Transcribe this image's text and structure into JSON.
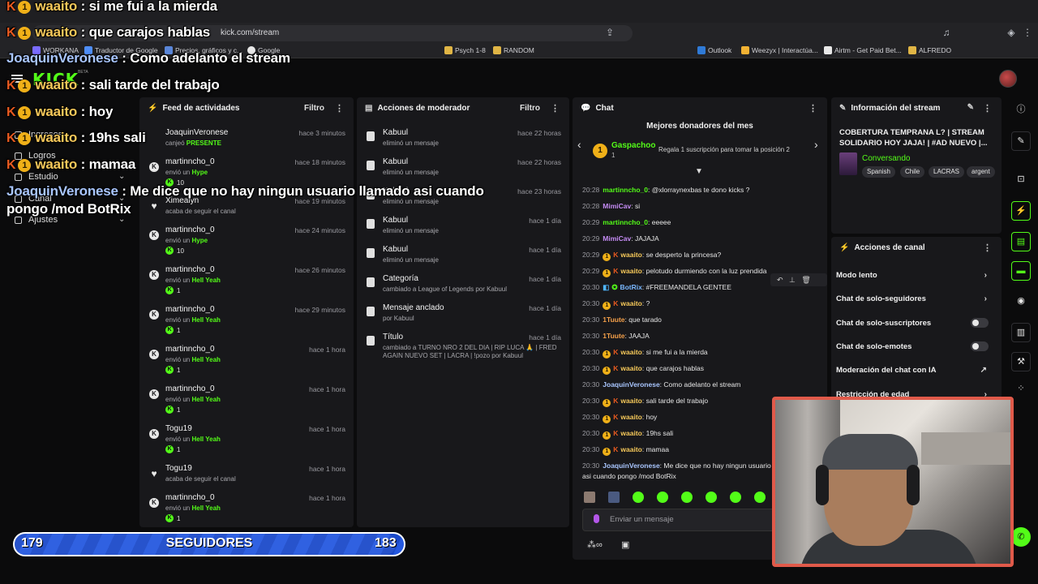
{
  "browser": {
    "url": "kick.com/stream",
    "bookmarks": [
      "WORKANA",
      "Traductor de Google",
      "Precios, gráficos y c...",
      "Google",
      "Psych 1-8",
      "RANDOM",
      "Outlook",
      "Weezyx | Interactúa...",
      "Airtm - Get Paid Bet...",
      "ALFREDO"
    ]
  },
  "kick": {
    "logo": "KICK",
    "beta": "BETA"
  },
  "side_nav": {
    "items": [
      "Ingresos",
      "Logros",
      "Estudio",
      "Canal",
      "Ajustes"
    ]
  },
  "feed": {
    "title": "Feed de actividades",
    "filter": "Filtro",
    "items": [
      {
        "name": "JoaquinVeronese",
        "time": "hace 3 minutos",
        "sub_pre": "canjeó ",
        "sub_hi": "PRESENTE",
        "amount": "",
        "icon": "gift-icon"
      },
      {
        "name": "martinncho_0",
        "time": "hace 18 minutos",
        "sub_pre": "envió un ",
        "sub_hi": "Hype",
        "amount": "10",
        "icon": "kick-coin-icon"
      },
      {
        "name": "Ximealyn",
        "time": "hace 19 minutos",
        "sub_pre": "acaba de seguir el canal",
        "sub_hi": "",
        "amount": "",
        "icon": "heart-icon"
      },
      {
        "name": "martinncho_0",
        "time": "hace 24 minutos",
        "sub_pre": "envió un ",
        "sub_hi": "Hype",
        "amount": "10",
        "icon": "kick-coin-icon"
      },
      {
        "name": "martinncho_0",
        "time": "hace 26 minutos",
        "sub_pre": "envió un ",
        "sub_hi": "Hell Yeah",
        "amount": "1",
        "icon": "kick-coin-icon"
      },
      {
        "name": "martinncho_0",
        "time": "hace 29 minutos",
        "sub_pre": "envió un ",
        "sub_hi": "Hell Yeah",
        "amount": "1",
        "icon": "kick-coin-icon"
      },
      {
        "name": "martinncho_0",
        "time": "hace 1 hora",
        "sub_pre": "envió un ",
        "sub_hi": "Hell Yeah",
        "amount": "1",
        "icon": "kick-coin-icon"
      },
      {
        "name": "martinncho_0",
        "time": "hace 1 hora",
        "sub_pre": "envió un ",
        "sub_hi": "Hell Yeah",
        "amount": "1",
        "icon": "kick-coin-icon"
      },
      {
        "name": "Togu19",
        "time": "hace 1 hora",
        "sub_pre": "envió un ",
        "sub_hi": "Hell Yeah",
        "amount": "1",
        "icon": "kick-coin-icon"
      },
      {
        "name": "Togu19",
        "time": "hace 1 hora",
        "sub_pre": "acaba de seguir el canal",
        "sub_hi": "",
        "amount": "",
        "icon": "heart-icon"
      },
      {
        "name": "martinncho_0",
        "time": "hace 1 hora",
        "sub_pre": "envió un ",
        "sub_hi": "Hell Yeah",
        "amount": "1",
        "icon": "kick-coin-icon"
      }
    ]
  },
  "mod": {
    "title": "Acciones de moderador",
    "filter": "Filtro",
    "items": [
      {
        "name": "Kabuul",
        "time": "hace 22 horas",
        "sub": "eliminó un mensaje",
        "sub2": ""
      },
      {
        "name": "Kabuul",
        "time": "hace 22 horas",
        "sub": "eliminó un mensaje",
        "sub2": ""
      },
      {
        "name": "Kabuul",
        "time": "hace 23 horas",
        "sub": "eliminó un mensaje",
        "sub2": ""
      },
      {
        "name": "Kabuul",
        "time": "hace 1 día",
        "sub": "eliminó un mensaje",
        "sub2": ""
      },
      {
        "name": "Kabuul",
        "time": "hace 1 día",
        "sub": "eliminó un mensaje",
        "sub2": ""
      },
      {
        "name": "Categoría",
        "time": "hace 1 día",
        "sub": "cambiado a League of Legends  por Kabuul",
        "sub2": ""
      },
      {
        "name": "Mensaje anclado",
        "time": "hace 1 día",
        "sub": "por Kabuul",
        "sub2": ""
      },
      {
        "name": "Título",
        "time": "hace 1 día",
        "sub": "cambiado a TURNO NRO 2 DEL DIA | RIP LUCA 🙏 | FRED",
        "sub2": "AGAIN NUEVO SET | LACRA | !pozo  por Kabuul"
      }
    ]
  },
  "chat": {
    "title": "Chat",
    "donors_title": "Mejores donadores del mes",
    "donor_name": "Gaspachoo",
    "donor_pos": "1",
    "donor_promo": "Regala 1 suscripción para tomar la posición 2",
    "input_placeholder": "Enviar un mensaje",
    "messages": [
      {
        "t": "20:28",
        "u": "martinncho_0",
        "m": ": @xlorraynexbas te dono kicks ?",
        "c": "#53fc18",
        "badge": false
      },
      {
        "t": "20:28",
        "u": "MimiCav",
        "m": ": si",
        "c": "#c58cf5",
        "badge": false
      },
      {
        "t": "20:29",
        "u": "martinncho_0",
        "m": ": eeeee",
        "c": "#53fc18",
        "badge": false
      },
      {
        "t": "20:29",
        "u": "MimiCav",
        "m": ": JAJAJA",
        "c": "#c58cf5",
        "badge": false
      },
      {
        "t": "20:29",
        "u": "waaito",
        "m": ": se desperto la princesa?",
        "c": "#f5c85a",
        "badge": true
      },
      {
        "t": "20:29",
        "u": "waaito",
        "m": ": pelotudo durmiendo con la luz prendida",
        "c": "#f5c85a",
        "badge": true
      },
      {
        "t": "20:30",
        "u": "BotRix",
        "m": ": #FREEMANDELA GENTEE",
        "c": "#7ab8ff",
        "badge": false
      },
      {
        "t": "20:30",
        "u": "waaito",
        "m": ": ?",
        "c": "#f5c85a",
        "badge": true
      },
      {
        "t": "20:30",
        "u": "1Tuute",
        "m": ": que tarado",
        "c": "#f5a04a",
        "badge": false
      },
      {
        "t": "20:30",
        "u": "1Tuute",
        "m": ": JAAJA",
        "c": "#f5a04a",
        "badge": false
      },
      {
        "t": "20:30",
        "u": "waaito",
        "m": ": si me fui a la mierda",
        "c": "#f5c85a",
        "badge": true
      },
      {
        "t": "20:30",
        "u": "waaito",
        "m": ": que carajos hablas",
        "c": "#f5c85a",
        "badge": true
      },
      {
        "t": "20:30",
        "u": "JoaquinVeronese",
        "m": ": Como adelanto el stream",
        "c": "#a9c6ff",
        "badge": false
      },
      {
        "t": "20:30",
        "u": "waaito",
        "m": ": sali tarde del trabajo",
        "c": "#f5c85a",
        "badge": true
      },
      {
        "t": "20:30",
        "u": "waaito",
        "m": ": hoy",
        "c": "#f5c85a",
        "badge": true
      },
      {
        "t": "20:30",
        "u": "waaito",
        "m": ": 19hs sali",
        "c": "#f5c85a",
        "badge": true
      },
      {
        "t": "20:30",
        "u": "waaito",
        "m": ": mamaa",
        "c": "#f5c85a",
        "badge": true
      },
      {
        "t": "20:30",
        "u": "JoaquinVeronese",
        "m": ": Me dice que no hay ningun usuario llamado",
        "c": "#a9c6ff",
        "badge": false
      }
    ],
    "last_wrap": "asi cuando pongo /mod BotRix"
  },
  "stream_info": {
    "title": "Información del stream",
    "stream_title": "COBERTURA TEMPRANA L? | STREAM SOLIDARIO HOY JAJA! | #AD NUEVO |...",
    "category": "Conversando",
    "tags": [
      "Spanish",
      "Chile",
      "LACRAS",
      "argent"
    ]
  },
  "channel_actions": {
    "title": "Acciones de canal",
    "items": [
      {
        "label": "Modo lento",
        "kind": "chevron"
      },
      {
        "label": "Chat de solo-seguidores",
        "kind": "chevron"
      },
      {
        "label": "Chat de solo-suscriptores",
        "kind": "toggle"
      },
      {
        "label": "Chat de solo-emotes",
        "kind": "toggle"
      },
      {
        "label": "Moderación del chat con IA",
        "kind": "link"
      },
      {
        "label": "Restricción de edad",
        "kind": "chevron"
      }
    ]
  },
  "overlay": {
    "lines": [
      {
        "u": "waaito",
        "m": " : si me fui a la mierda",
        "blue": false,
        "badge": true
      },
      {
        "u": "waaito",
        "m": " : que carajos hablas",
        "blue": false,
        "badge": true
      },
      {
        "u": "JoaquinVeronese",
        "m": " : Como adelanto el stream",
        "blue": true,
        "badge": false
      },
      {
        "u": "waaito",
        "m": " : sali tarde del trabajo",
        "blue": false,
        "badge": true
      },
      {
        "u": "waaito",
        "m": " : hoy",
        "blue": false,
        "badge": true
      },
      {
        "u": "waaito",
        "m": " : 19hs sali",
        "blue": false,
        "badge": true
      },
      {
        "u": "waaito",
        "m": " : mamaa",
        "blue": false,
        "badge": true
      },
      {
        "u": "JoaquinVeronese",
        "m": " : Me dice que no hay ningun usuario llamado asi cuando pongo /mod BotRix",
        "blue": true,
        "badge": false
      }
    ]
  },
  "followers": {
    "current": "179",
    "label": "SEGUIDORES",
    "goal": "183"
  }
}
